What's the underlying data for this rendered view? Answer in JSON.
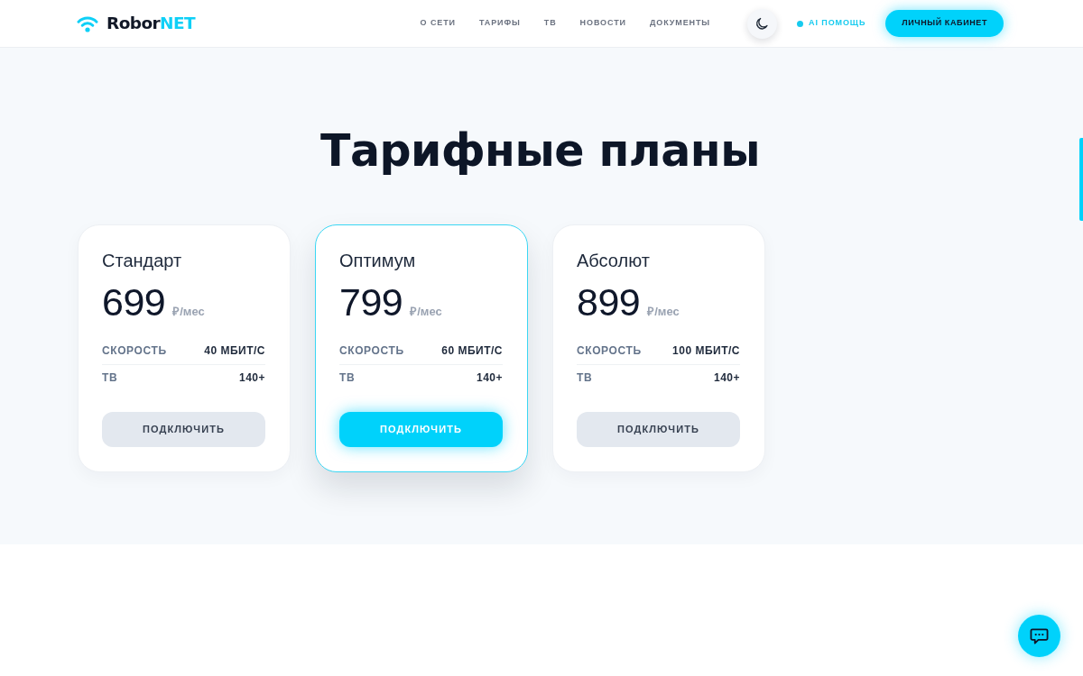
{
  "header": {
    "logo": {
      "name": "Robor",
      "name_accent": "NET"
    },
    "nav": [
      {
        "label": "О СЕТИ"
      },
      {
        "label": "ТАРИФЫ"
      },
      {
        "label": "ТВ"
      },
      {
        "label": "НОВОСТИ"
      },
      {
        "label": "ДОКУМЕНТЫ"
      }
    ],
    "ai_help": "AI ПОМОЩЬ",
    "account_button": "ЛИЧНЫЙ КАБИНЕТ"
  },
  "pricing": {
    "title": "Тарифные планы",
    "plans": [
      {
        "name": "Стандарт",
        "price": "699",
        "unit": "₽/мес",
        "features": [
          {
            "label": "СКОРОСТЬ",
            "value": "40 МБИТ/С"
          },
          {
            "label": "ТВ",
            "value": "140+"
          }
        ],
        "button": "ПОДКЛЮЧИТЬ",
        "selected": false
      },
      {
        "name": "Оптимум",
        "price": "799",
        "unit": "₽/мес",
        "features": [
          {
            "label": "СКОРОСТЬ",
            "value": "60 МБИТ/С"
          },
          {
            "label": "ТВ",
            "value": "140+"
          }
        ],
        "button": "ПОДКЛЮЧИТЬ",
        "selected": true
      },
      {
        "name": "Абсолют",
        "price": "899",
        "unit": "₽/мес",
        "features": [
          {
            "label": "СКОРОСТЬ",
            "value": "100 МБИТ/С"
          },
          {
            "label": "ТВ",
            "value": "140+"
          }
        ],
        "button": "ПОДКЛЮЧИТЬ",
        "selected": false
      }
    ]
  }
}
